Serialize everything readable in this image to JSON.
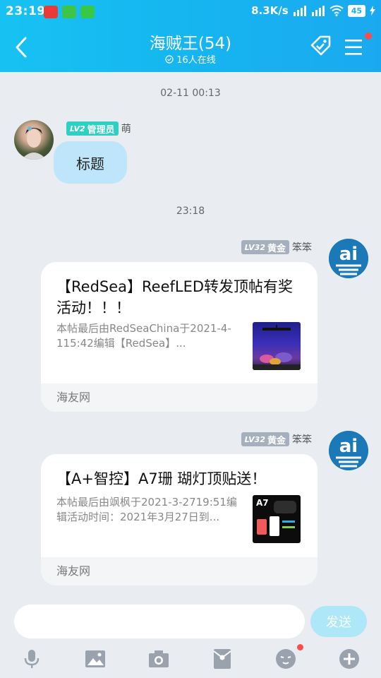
{
  "status_bar": {
    "time": "23:19",
    "network_speed": "8.3K/s",
    "battery": "45"
  },
  "header": {
    "title": "海贼王(54)",
    "online": "16人在线"
  },
  "messages": [
    {
      "type": "time",
      "text": "02-11 00:13"
    },
    {
      "type": "incoming",
      "level": "LV2",
      "role": "管理员",
      "nickname": "萌",
      "text": "标题"
    },
    {
      "type": "time",
      "text": "23:18"
    },
    {
      "type": "outgoing_card",
      "level": "LV32",
      "role": "黄金",
      "nickname": "笨笨",
      "avatar_text": "ai",
      "card_title": "【RedSea】ReefLED转发顶帖有奖活动！！！",
      "card_desc": "本帖最后由RedSeaChina于2021-4-115:42编辑【RedSea】...",
      "source": "海友网"
    },
    {
      "type": "outgoing_card",
      "level": "LV32",
      "role": "黄金",
      "nickname": "笨笨",
      "avatar_text": "ai",
      "card_title": "【A+智控】A7珊 瑚灯顶贴送！",
      "card_desc": "本帖最后由飒枫于2021-3-2719:51编辑活动时间：2021年3月27日到...",
      "thumb_label": "A7",
      "source": "海友网"
    }
  ],
  "input": {
    "placeholder": "",
    "send_label": "发送"
  },
  "toolbar": [
    "mic-icon",
    "image-icon",
    "camera-icon",
    "red-packet-icon",
    "emoji-icon",
    "plus-icon"
  ],
  "colors": {
    "header": "#16b4f0",
    "bubble": "#bfe5fa",
    "admin_badge": "#2dd0c3",
    "gold_badge": "#a6b0bd",
    "send_button": "#aee7f7",
    "notify_dot": "#ff4b4b"
  }
}
